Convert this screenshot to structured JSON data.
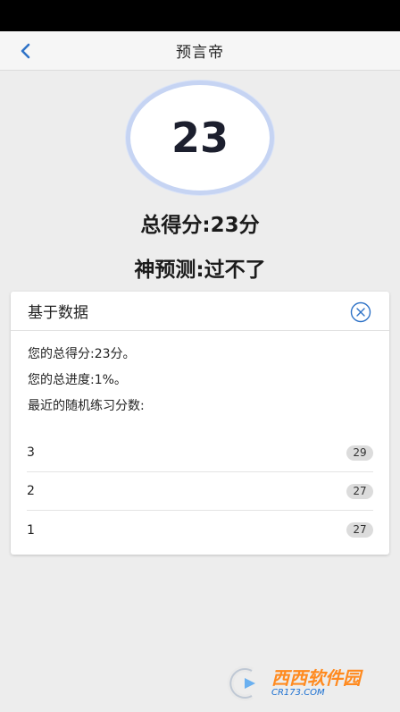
{
  "header": {
    "title": "预言帝"
  },
  "score": {
    "value": "23"
  },
  "summary": {
    "total_line": "总得分:23分",
    "predict_line": "神预测:过不了"
  },
  "card": {
    "title": "基于数据",
    "lines": [
      "您的总得分:23分。",
      "您的总进度:1%。",
      "最近的随机练习分数:"
    ],
    "recent_scores": [
      {
        "label": "3",
        "score": "29"
      },
      {
        "label": "2",
        "score": "27"
      },
      {
        "label": "1",
        "score": "27"
      }
    ]
  },
  "watermark": {
    "brand": "西西软件园",
    "site": "CR173.COM"
  },
  "colors": {
    "accent": "#2f73c7",
    "ring": "#c6d4f3",
    "badge": "#dcdcdc"
  }
}
